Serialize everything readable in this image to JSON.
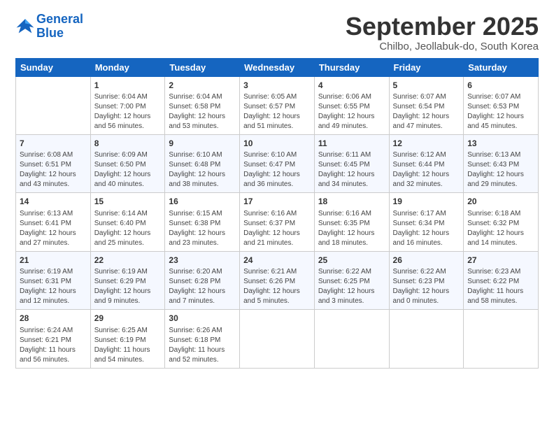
{
  "logo": {
    "line1": "General",
    "line2": "Blue"
  },
  "title": "September 2025",
  "subtitle": "Chilbo, Jeollabuk-do, South Korea",
  "weekdays": [
    "Sunday",
    "Monday",
    "Tuesday",
    "Wednesday",
    "Thursday",
    "Friday",
    "Saturday"
  ],
  "weeks": [
    [
      {
        "day": "",
        "info": ""
      },
      {
        "day": "1",
        "info": "Sunrise: 6:04 AM\nSunset: 7:00 PM\nDaylight: 12 hours\nand 56 minutes."
      },
      {
        "day": "2",
        "info": "Sunrise: 6:04 AM\nSunset: 6:58 PM\nDaylight: 12 hours\nand 53 minutes."
      },
      {
        "day": "3",
        "info": "Sunrise: 6:05 AM\nSunset: 6:57 PM\nDaylight: 12 hours\nand 51 minutes."
      },
      {
        "day": "4",
        "info": "Sunrise: 6:06 AM\nSunset: 6:55 PM\nDaylight: 12 hours\nand 49 minutes."
      },
      {
        "day": "5",
        "info": "Sunrise: 6:07 AM\nSunset: 6:54 PM\nDaylight: 12 hours\nand 47 minutes."
      },
      {
        "day": "6",
        "info": "Sunrise: 6:07 AM\nSunset: 6:53 PM\nDaylight: 12 hours\nand 45 minutes."
      }
    ],
    [
      {
        "day": "7",
        "info": "Sunrise: 6:08 AM\nSunset: 6:51 PM\nDaylight: 12 hours\nand 43 minutes."
      },
      {
        "day": "8",
        "info": "Sunrise: 6:09 AM\nSunset: 6:50 PM\nDaylight: 12 hours\nand 40 minutes."
      },
      {
        "day": "9",
        "info": "Sunrise: 6:10 AM\nSunset: 6:48 PM\nDaylight: 12 hours\nand 38 minutes."
      },
      {
        "day": "10",
        "info": "Sunrise: 6:10 AM\nSunset: 6:47 PM\nDaylight: 12 hours\nand 36 minutes."
      },
      {
        "day": "11",
        "info": "Sunrise: 6:11 AM\nSunset: 6:45 PM\nDaylight: 12 hours\nand 34 minutes."
      },
      {
        "day": "12",
        "info": "Sunrise: 6:12 AM\nSunset: 6:44 PM\nDaylight: 12 hours\nand 32 minutes."
      },
      {
        "day": "13",
        "info": "Sunrise: 6:13 AM\nSunset: 6:43 PM\nDaylight: 12 hours\nand 29 minutes."
      }
    ],
    [
      {
        "day": "14",
        "info": "Sunrise: 6:13 AM\nSunset: 6:41 PM\nDaylight: 12 hours\nand 27 minutes."
      },
      {
        "day": "15",
        "info": "Sunrise: 6:14 AM\nSunset: 6:40 PM\nDaylight: 12 hours\nand 25 minutes."
      },
      {
        "day": "16",
        "info": "Sunrise: 6:15 AM\nSunset: 6:38 PM\nDaylight: 12 hours\nand 23 minutes."
      },
      {
        "day": "17",
        "info": "Sunrise: 6:16 AM\nSunset: 6:37 PM\nDaylight: 12 hours\nand 21 minutes."
      },
      {
        "day": "18",
        "info": "Sunrise: 6:16 AM\nSunset: 6:35 PM\nDaylight: 12 hours\nand 18 minutes."
      },
      {
        "day": "19",
        "info": "Sunrise: 6:17 AM\nSunset: 6:34 PM\nDaylight: 12 hours\nand 16 minutes."
      },
      {
        "day": "20",
        "info": "Sunrise: 6:18 AM\nSunset: 6:32 PM\nDaylight: 12 hours\nand 14 minutes."
      }
    ],
    [
      {
        "day": "21",
        "info": "Sunrise: 6:19 AM\nSunset: 6:31 PM\nDaylight: 12 hours\nand 12 minutes."
      },
      {
        "day": "22",
        "info": "Sunrise: 6:19 AM\nSunset: 6:29 PM\nDaylight: 12 hours\nand 9 minutes."
      },
      {
        "day": "23",
        "info": "Sunrise: 6:20 AM\nSunset: 6:28 PM\nDaylight: 12 hours\nand 7 minutes."
      },
      {
        "day": "24",
        "info": "Sunrise: 6:21 AM\nSunset: 6:26 PM\nDaylight: 12 hours\nand 5 minutes."
      },
      {
        "day": "25",
        "info": "Sunrise: 6:22 AM\nSunset: 6:25 PM\nDaylight: 12 hours\nand 3 minutes."
      },
      {
        "day": "26",
        "info": "Sunrise: 6:22 AM\nSunset: 6:23 PM\nDaylight: 12 hours\nand 0 minutes."
      },
      {
        "day": "27",
        "info": "Sunrise: 6:23 AM\nSunset: 6:22 PM\nDaylight: 11 hours\nand 58 minutes."
      }
    ],
    [
      {
        "day": "28",
        "info": "Sunrise: 6:24 AM\nSunset: 6:21 PM\nDaylight: 11 hours\nand 56 minutes."
      },
      {
        "day": "29",
        "info": "Sunrise: 6:25 AM\nSunset: 6:19 PM\nDaylight: 11 hours\nand 54 minutes."
      },
      {
        "day": "30",
        "info": "Sunrise: 6:26 AM\nSunset: 6:18 PM\nDaylight: 11 hours\nand 52 minutes."
      },
      {
        "day": "",
        "info": ""
      },
      {
        "day": "",
        "info": ""
      },
      {
        "day": "",
        "info": ""
      },
      {
        "day": "",
        "info": ""
      }
    ]
  ]
}
